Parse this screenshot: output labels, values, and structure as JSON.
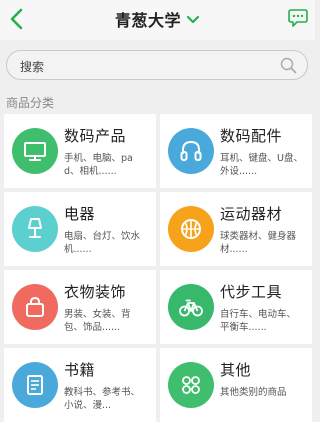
{
  "header": {
    "title": "青葱大学"
  },
  "search": {
    "placeholder": "搜索"
  },
  "section": {
    "label": "商品分类"
  },
  "categories": [
    {
      "name": "数码产品",
      "desc": "手机、电脑、pad、相机......",
      "color": "#3fbf6e",
      "icon": "monitor-icon"
    },
    {
      "name": "数码配件",
      "desc": "耳机、键盘、U盘、外设......",
      "color": "#4aa9db",
      "icon": "headphones-icon"
    },
    {
      "name": "电器",
      "desc": "电扇、台灯、饮水机......",
      "color": "#5ccfcf",
      "icon": "lamp-icon"
    },
    {
      "name": "运动器材",
      "desc": "球类器材、健身器材......",
      "color": "#f7a21b",
      "icon": "basketball-icon"
    },
    {
      "name": "衣物装饰",
      "desc": "男装、女装、背包、饰品......",
      "color": "#f06a5f",
      "icon": "bag-icon"
    },
    {
      "name": "代步工具",
      "desc": "自行车、电动车、平衡车......",
      "color": "#37b86b",
      "icon": "bicycle-icon"
    },
    {
      "name": "书籍",
      "desc": "教科书、参考书、小说、漫...",
      "color": "#4aa9db",
      "icon": "book-icon"
    },
    {
      "name": "其他",
      "desc": "其他类别的商品",
      "color": "#3fbf6e",
      "icon": "grid-icon"
    }
  ]
}
